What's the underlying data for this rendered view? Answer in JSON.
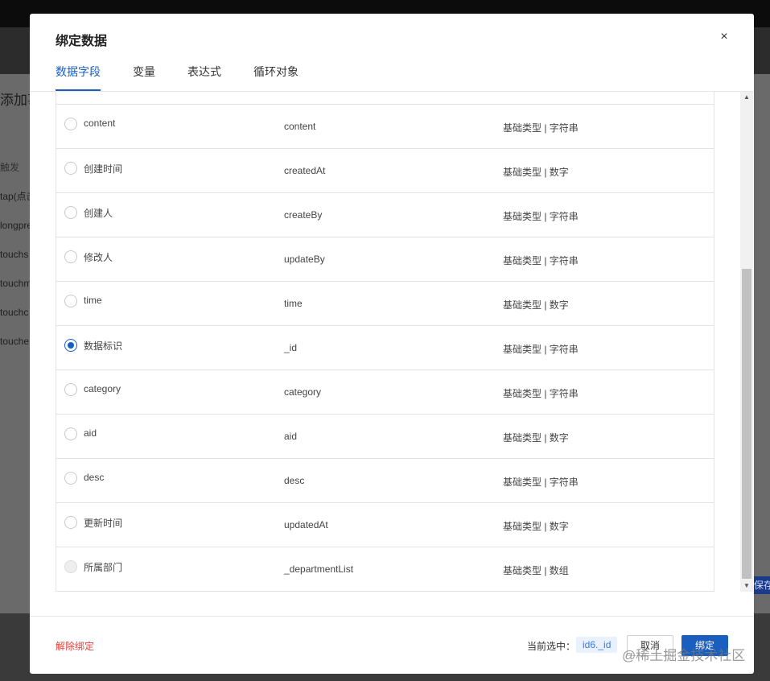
{
  "background": {
    "title": "添加事",
    "hint": "触发",
    "events": [
      "tap(点击",
      "longpre",
      "touchs",
      "touchm",
      "touchc",
      "touche"
    ],
    "save_label": "保存"
  },
  "modal": {
    "title": "绑定数据",
    "close_label": "×",
    "tabs": [
      {
        "label": "数据字段",
        "active": true
      },
      {
        "label": "变量",
        "active": false
      },
      {
        "label": "表达式",
        "active": false
      },
      {
        "label": "循环对象",
        "active": false
      }
    ],
    "rows": [
      {
        "name": "content",
        "key": "content",
        "type": "基础类型 | 字符串",
        "state": "unchecked"
      },
      {
        "name": "创建时间",
        "key": "createdAt",
        "type": "基础类型 | 数字",
        "state": "unchecked"
      },
      {
        "name": "创建人",
        "key": "createBy",
        "type": "基础类型 | 字符串",
        "state": "unchecked"
      },
      {
        "name": "修改人",
        "key": "updateBy",
        "type": "基础类型 | 字符串",
        "state": "unchecked"
      },
      {
        "name": "time",
        "key": "time",
        "type": "基础类型 | 数字",
        "state": "unchecked"
      },
      {
        "name": "数据标识",
        "key": "_id",
        "type": "基础类型 | 字符串",
        "state": "checked"
      },
      {
        "name": "category",
        "key": "category",
        "type": "基础类型 | 字符串",
        "state": "unchecked"
      },
      {
        "name": "aid",
        "key": "aid",
        "type": "基础类型 | 数字",
        "state": "unchecked"
      },
      {
        "name": "desc",
        "key": "desc",
        "type": "基础类型 | 字符串",
        "state": "unchecked"
      },
      {
        "name": "更新时间",
        "key": "updatedAt",
        "type": "基础类型 | 数字",
        "state": "unchecked"
      },
      {
        "name": "所属部门",
        "key": "_departmentList",
        "type": "基础类型 | 数组",
        "state": "disabled"
      }
    ],
    "footer": {
      "unbind_label": "解除绑定",
      "selected_label": "当前选中：",
      "selected_value": "id6._id",
      "cancel_label": "取消",
      "bind_label": "绑定"
    }
  },
  "watermark": "@稀土掘金技术社区",
  "colors": {
    "accent": "#1a5fc0",
    "danger": "#e0423b",
    "tag_bg": "#e8f1fd"
  }
}
